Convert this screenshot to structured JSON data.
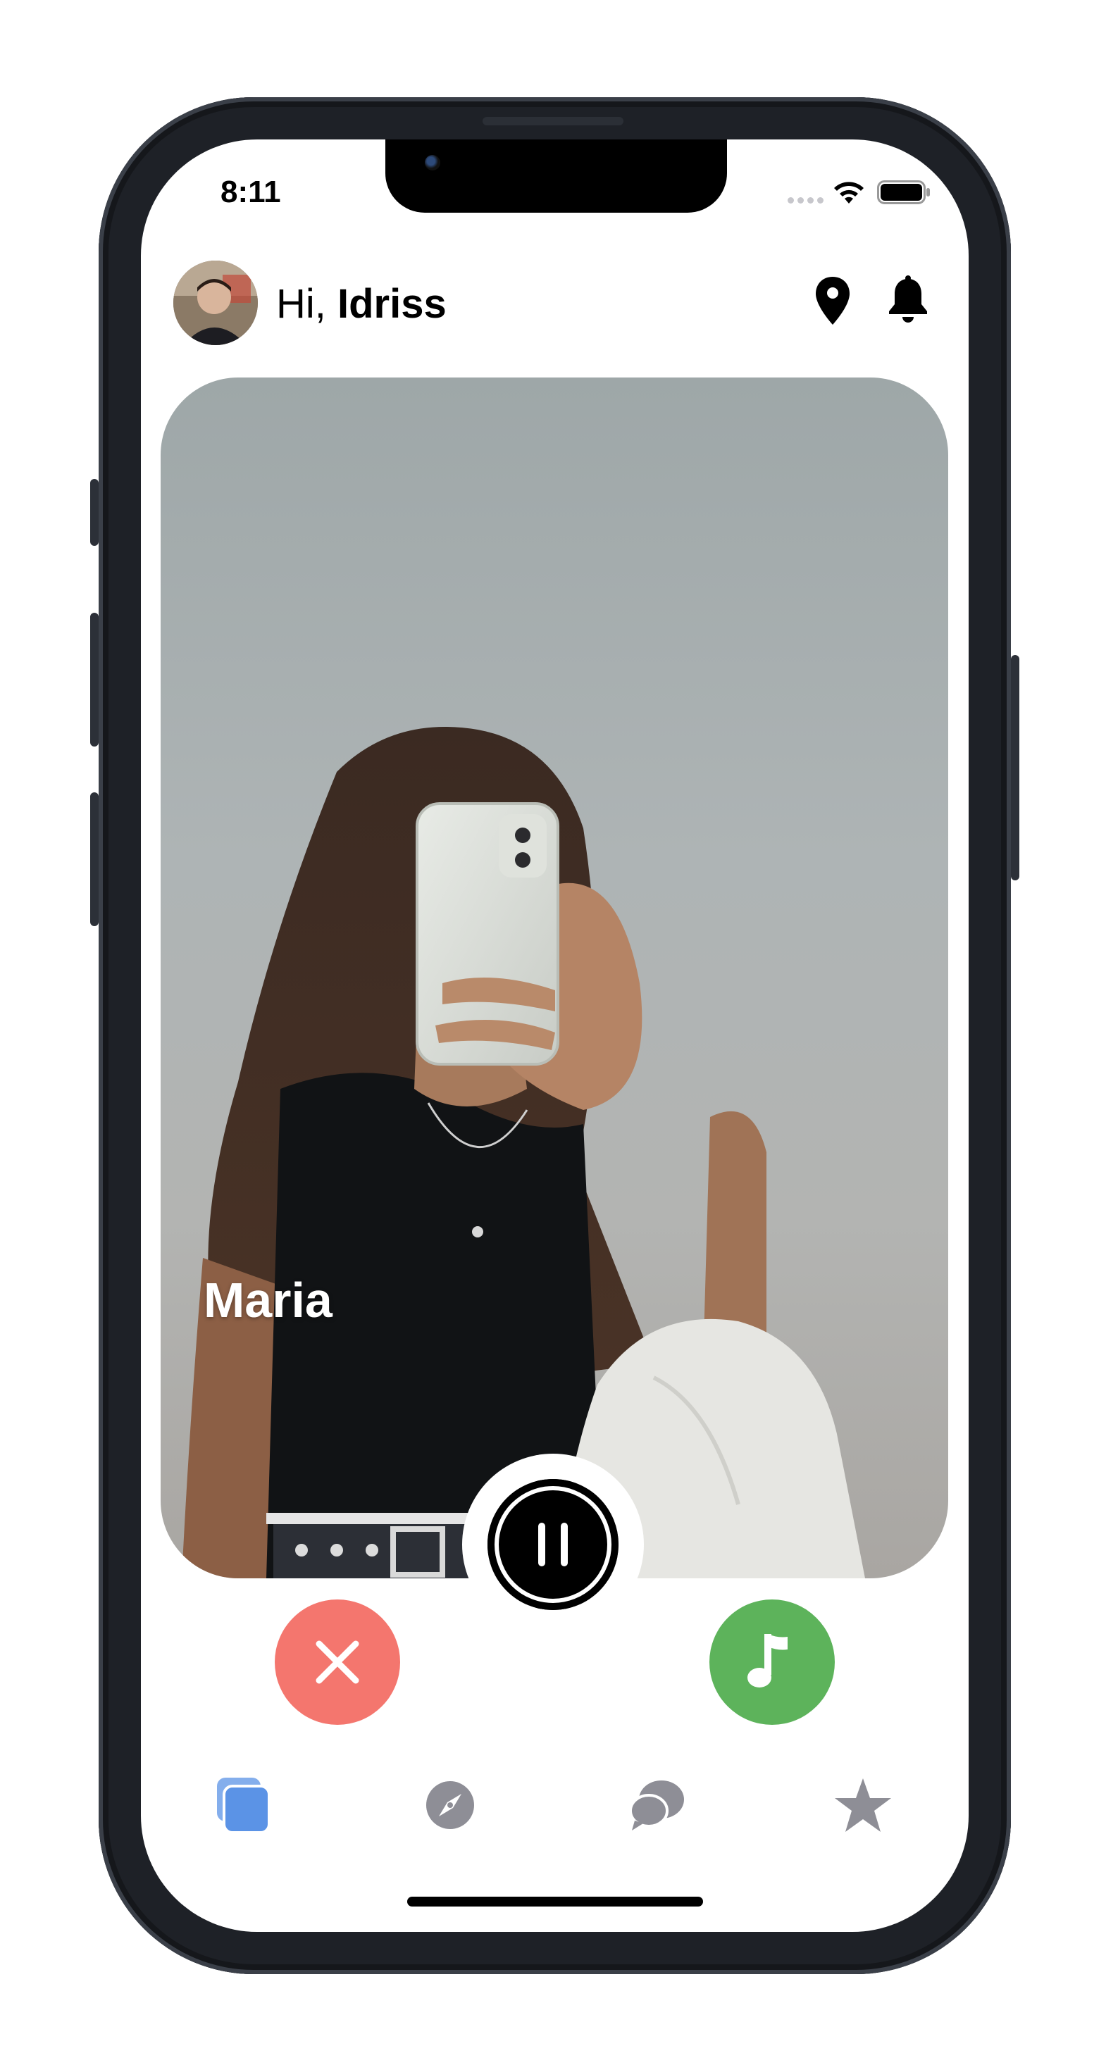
{
  "status_bar": {
    "time": "8:11"
  },
  "header": {
    "greeting_prefix": "Hi, ",
    "user_name": "Idriss",
    "avatar_icon": "user-avatar",
    "location_icon": "map-pin-icon",
    "notifications_icon": "bell-icon"
  },
  "profile_card": {
    "name": "Maria"
  },
  "player": {
    "state": "playing",
    "control_icon": "pause-icon"
  },
  "actions": {
    "reject_icon": "close-icon",
    "like_icon": "music-note-icon"
  },
  "tabs": [
    {
      "icon": "cards-icon",
      "active": true
    },
    {
      "icon": "compass-icon",
      "active": false
    },
    {
      "icon": "chat-bubbles-icon",
      "active": false
    },
    {
      "icon": "star-icon",
      "active": false
    }
  ],
  "colors": {
    "accent_blue": "#5b93e6",
    "reject_red": "#f4766e",
    "like_green": "#5db35b",
    "inactive_tab": "#8e8e96"
  }
}
